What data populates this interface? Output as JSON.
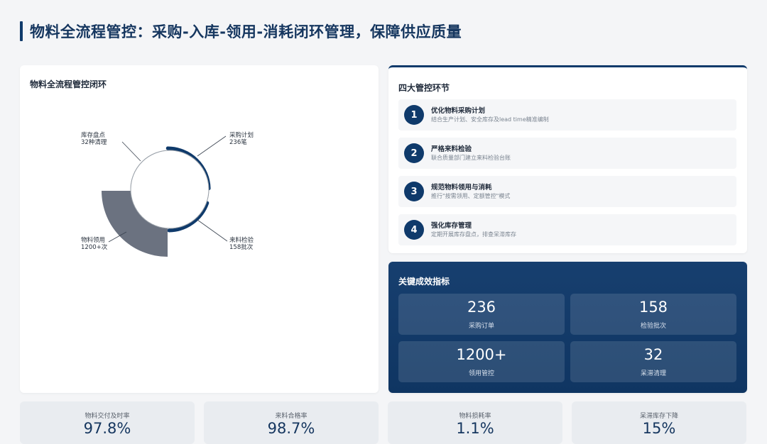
{
  "page_title": "物料全流程管控：采购-入库-领用-消耗闭环管理，保障供应质量",
  "loop_card": {
    "title": "物料全流程管控闭环",
    "segments": [
      {
        "name": "采购计划",
        "detail": "236笔"
      },
      {
        "name": "来料检验",
        "detail": "158批次"
      },
      {
        "name": "物料领用",
        "detail": "1200+次"
      },
      {
        "name": "库存盘点",
        "detail": "32种清理"
      }
    ],
    "colors": {
      "primary": "#0f3a6b",
      "gray": "#6b7280",
      "ring": "#9aa1a9"
    }
  },
  "steps_card": {
    "title": "四大管控环节",
    "items": [
      {
        "num": "1",
        "title": "优化物料采购计划",
        "desc": "结合生产计划、安全库存及lead time精准编制"
      },
      {
        "num": "2",
        "title": "严格来料检验",
        "desc": "联合质量部门建立来料检验台账"
      },
      {
        "num": "3",
        "title": "规范物料领用与消耗",
        "desc": "推行\"按需领用、定额管控\"模式"
      },
      {
        "num": "4",
        "title": "强化库存管理",
        "desc": "定期开展库存盘点，排查呆滞库存"
      }
    ]
  },
  "kpi_card": {
    "title": "关键成效指标",
    "tiles": [
      {
        "value": "236",
        "label": "采购订单"
      },
      {
        "value": "158",
        "label": "检验批次"
      },
      {
        "value": "1200+",
        "label": "领用管控"
      },
      {
        "value": "32",
        "label": "呆滞清理"
      }
    ]
  },
  "bottom_stats": [
    {
      "label": "物料交付及时率",
      "value": "97.8%"
    },
    {
      "label": "来料合格率",
      "value": "98.7%"
    },
    {
      "label": "物料损耗率",
      "value": "1.1%"
    },
    {
      "label": "呆滞库存下降",
      "value": "15%"
    }
  ]
}
